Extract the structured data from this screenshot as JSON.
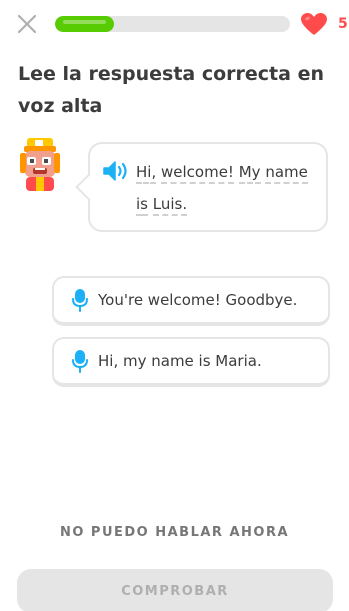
{
  "header": {
    "close_icon": "close-icon",
    "progress_fraction": 0.25,
    "hearts_count": "5",
    "heart_color": "#ff4b4b",
    "progress_color": "#58cc02"
  },
  "lesson": {
    "title": "Lee la respuesta correcta en voz alta",
    "prompt_words": [
      "Hi,",
      "welcome!",
      "My",
      "name",
      "is",
      "Luis."
    ],
    "speaker_icon": "speaker-icon",
    "accent_color": "#1cb0f6"
  },
  "options": [
    {
      "label": "You're welcome! Goodbye.",
      "icon": "microphone-icon"
    },
    {
      "label": "Hi, my name is Maria.",
      "icon": "microphone-icon"
    }
  ],
  "footer": {
    "cant_speak_label": "NO PUEDO HABLAR AHORA",
    "check_label": "COMPROBAR"
  }
}
